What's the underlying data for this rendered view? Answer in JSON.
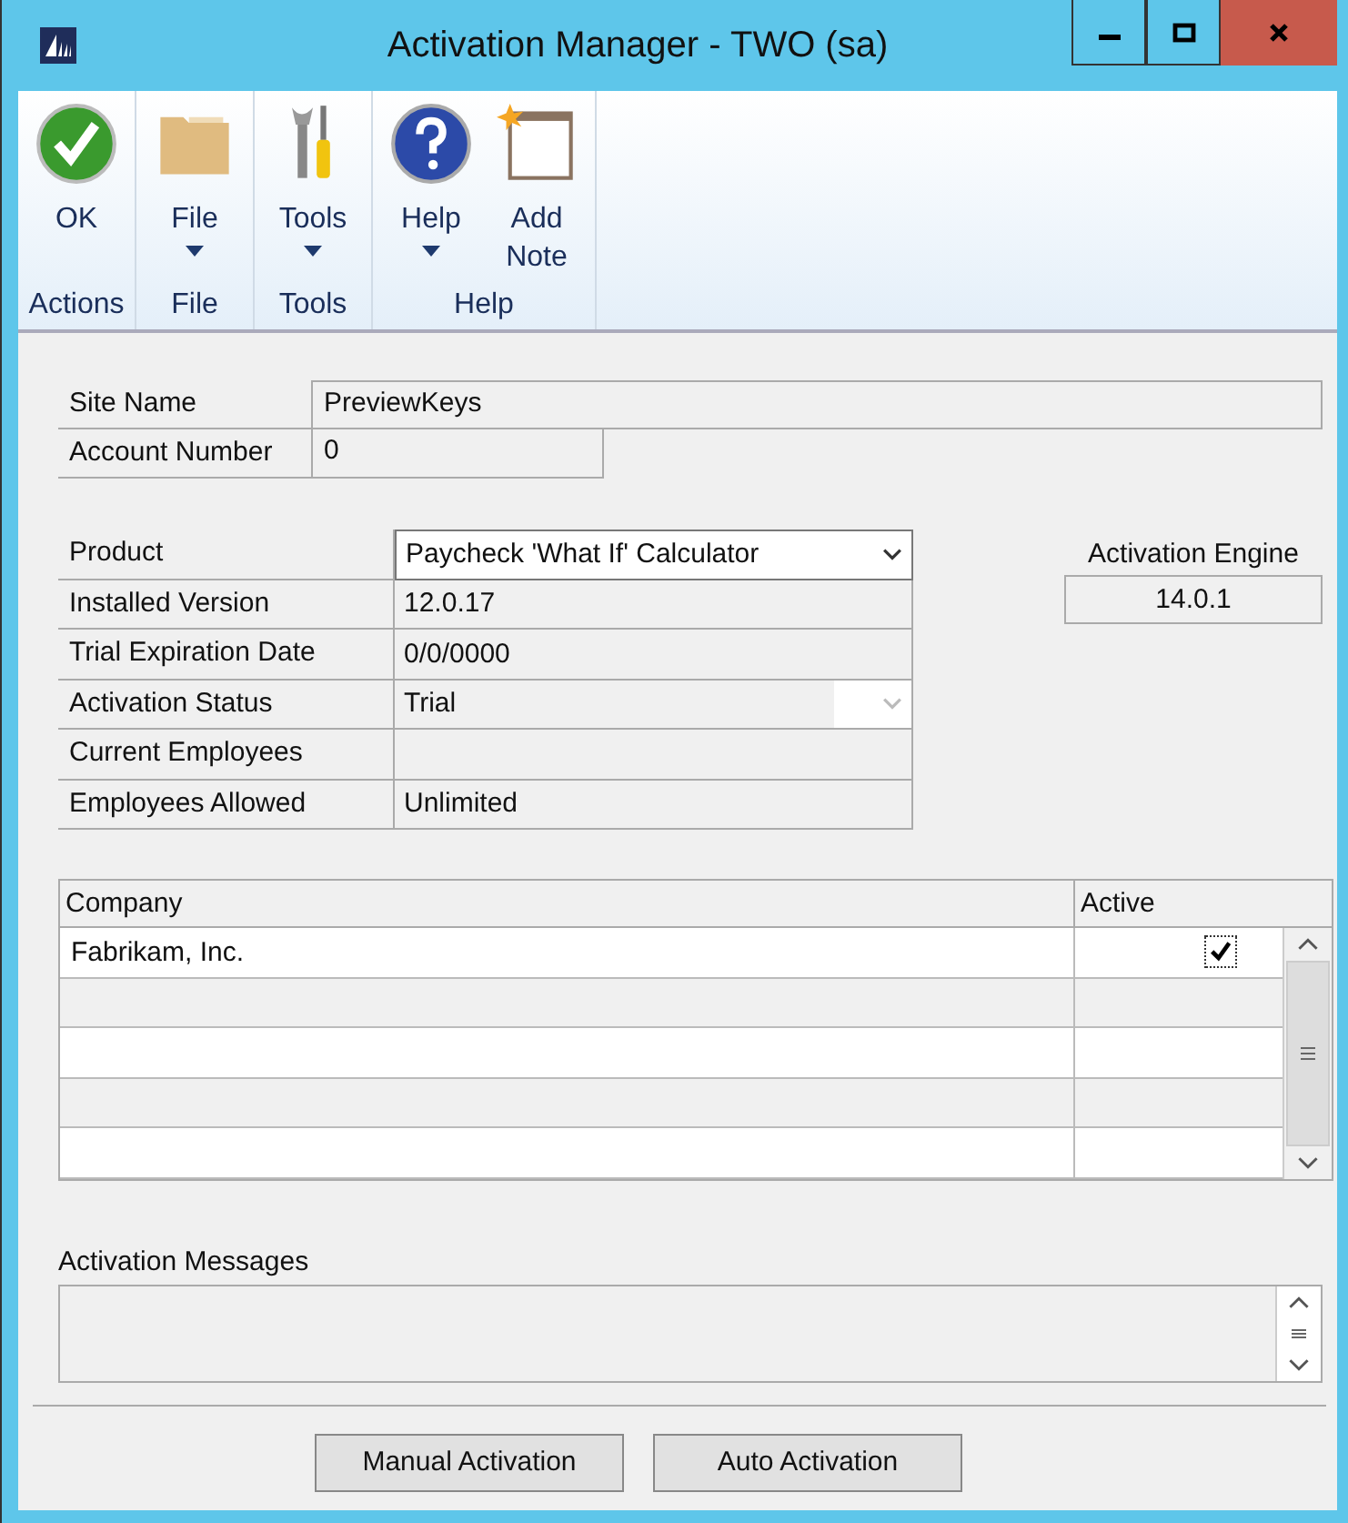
{
  "window": {
    "title": "Activation Manager  -  TWO (sa)"
  },
  "ribbon": [
    {
      "group": "Actions",
      "buttons": [
        {
          "label": "OK",
          "kind": "ok",
          "dropdown": false
        }
      ]
    },
    {
      "group": "File",
      "buttons": [
        {
          "label": "File",
          "kind": "folder",
          "dropdown": true
        }
      ]
    },
    {
      "group": "Tools",
      "buttons": [
        {
          "label": "Tools",
          "kind": "tools",
          "dropdown": true
        }
      ]
    },
    {
      "group": "Help",
      "buttons": [
        {
          "label": "Help",
          "kind": "help",
          "dropdown": true
        },
        {
          "label": "Add Note",
          "kind": "note",
          "dropdown": false
        }
      ]
    }
  ],
  "site": [
    {
      "label": "Site Name",
      "value": "PreviewKeys",
      "wide": true
    },
    {
      "label": "Account Number",
      "value": "0",
      "wide": false
    }
  ],
  "product": [
    {
      "label": "Product",
      "kind": "dropdown",
      "value": "Paycheck 'What If' Calculator"
    },
    {
      "label": "Installed Version",
      "kind": "text",
      "value": "12.0.17"
    },
    {
      "label": "Trial Expiration Date",
      "kind": "text",
      "value": "0/0/0000"
    },
    {
      "label": "Activation Status",
      "kind": "locked-dropdown",
      "value": "Trial"
    },
    {
      "label": "Current Employees",
      "kind": "text"
    },
    {
      "label": "Employees Allowed",
      "kind": "text",
      "value": "Unlimited"
    }
  ],
  "engine": {
    "label": "Activation Engine",
    "value": "14.0.1"
  },
  "grid": {
    "columns": [
      "Company",
      "Active"
    ],
    "rows": [
      {
        "company": "Fabrikam, Inc.",
        "checked": true
      }
    ]
  },
  "messages": {
    "label": "Activation Messages"
  },
  "buttons": [
    "Manual Activation",
    "Auto Activation"
  ]
}
